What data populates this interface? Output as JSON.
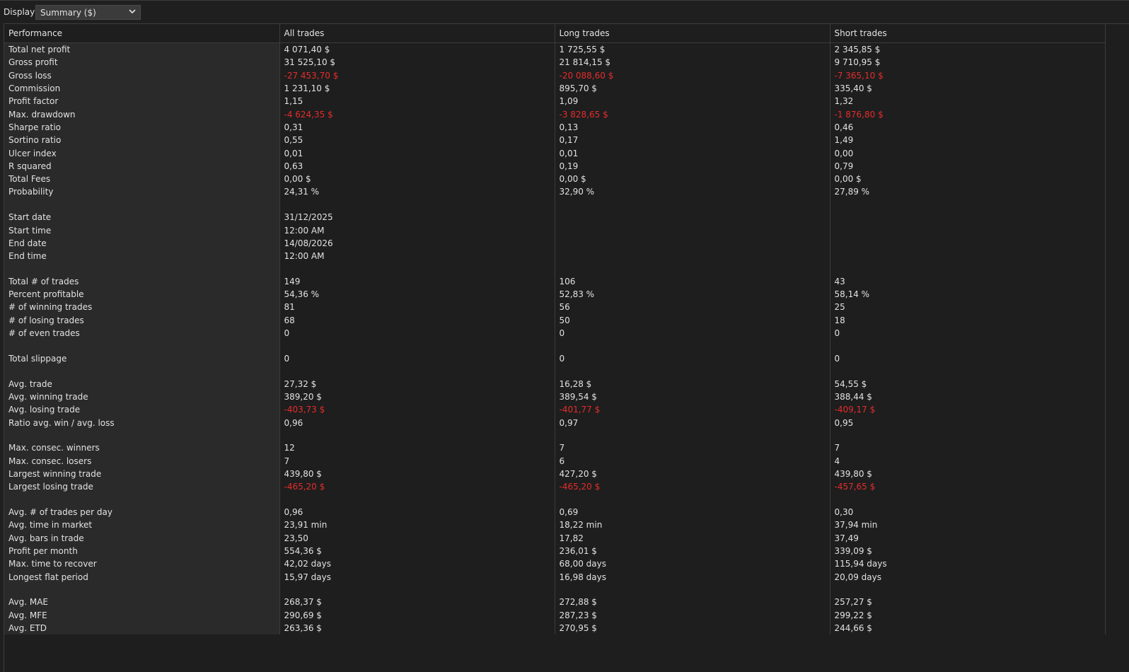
{
  "toolbar": {
    "display_label": "Display",
    "display_value": "Summary ($)"
  },
  "table": {
    "headers": [
      "Performance",
      "All trades",
      "Long trades",
      "Short trades"
    ],
    "rows": [
      {
        "label": "Total net profit",
        "all": "4 071,40 $",
        "long": "1 725,55 $",
        "short": "2 345,85 $"
      },
      {
        "label": "Gross profit",
        "all": "31 525,10 $",
        "long": "21 814,15 $",
        "short": "9 710,95 $"
      },
      {
        "label": "Gross loss",
        "all": "-27 453,70 $",
        "long": "-20 088,60 $",
        "short": "-7 365,10 $",
        "negative": true
      },
      {
        "label": "Commission",
        "all": "1 231,10 $",
        "long": "895,70 $",
        "short": "335,40 $"
      },
      {
        "label": "Profit factor",
        "all": "1,15",
        "long": "1,09",
        "short": "1,32"
      },
      {
        "label": "Max. drawdown",
        "all": "-4 624,35 $",
        "long": "-3 828,65 $",
        "short": "-1 876,80 $",
        "negative": true
      },
      {
        "label": "Sharpe ratio",
        "all": "0,31",
        "long": "0,13",
        "short": "0,46"
      },
      {
        "label": "Sortino ratio",
        "all": "0,55",
        "long": "0,17",
        "short": "1,49"
      },
      {
        "label": "Ulcer index",
        "all": "0,01",
        "long": "0,01",
        "short": "0,00"
      },
      {
        "label": "R squared",
        "all": "0,63",
        "long": "0,19",
        "short": "0,79"
      },
      {
        "label": "Total Fees",
        "all": "0,00 $",
        "long": "0,00 $",
        "short": "0,00 $"
      },
      {
        "label": "Probability",
        "all": "24,31 %",
        "long": "32,90 %",
        "short": "27,89 %"
      },
      {
        "gap": true
      },
      {
        "label": "Start date",
        "all": "31/12/2025",
        "long": "",
        "short": ""
      },
      {
        "label": "Start time",
        "all": "12:00 AM",
        "long": "",
        "short": ""
      },
      {
        "label": "End date",
        "all": "14/08/2026",
        "long": "",
        "short": ""
      },
      {
        "label": "End time",
        "all": "12:00 AM",
        "long": "",
        "short": ""
      },
      {
        "gap": true
      },
      {
        "label": "Total # of trades",
        "all": "149",
        "long": "106",
        "short": "43"
      },
      {
        "label": "Percent profitable",
        "all": "54,36 %",
        "long": "52,83 %",
        "short": "58,14 %"
      },
      {
        "label": "# of winning trades",
        "all": "81",
        "long": "56",
        "short": "25"
      },
      {
        "label": "# of losing trades",
        "all": "68",
        "long": "50",
        "short": "18"
      },
      {
        "label": "# of even trades",
        "all": "0",
        "long": "0",
        "short": "0"
      },
      {
        "gap": true
      },
      {
        "label": "Total slippage",
        "all": "0",
        "long": "0",
        "short": "0"
      },
      {
        "gap": true
      },
      {
        "label": "Avg. trade",
        "all": "27,32 $",
        "long": "16,28 $",
        "short": "54,55 $"
      },
      {
        "label": "Avg. winning trade",
        "all": "389,20 $",
        "long": "389,54 $",
        "short": "388,44 $"
      },
      {
        "label": "Avg. losing trade",
        "all": "-403,73 $",
        "long": "-401,77 $",
        "short": "-409,17 $",
        "negative": true
      },
      {
        "label": "Ratio avg. win / avg. loss",
        "all": "0,96",
        "long": "0,97",
        "short": "0,95"
      },
      {
        "gap": true
      },
      {
        "label": "Max. consec. winners",
        "all": "12",
        "long": "7",
        "short": "7"
      },
      {
        "label": "Max. consec. losers",
        "all": "7",
        "long": "6",
        "short": "4"
      },
      {
        "label": "Largest winning trade",
        "all": "439,80 $",
        "long": "427,20 $",
        "short": "439,80 $"
      },
      {
        "label": "Largest losing trade",
        "all": "-465,20 $",
        "long": "-465,20 $",
        "short": "-457,65 $",
        "negative": true
      },
      {
        "gap": true
      },
      {
        "label": "Avg. # of trades per day",
        "all": "0,96",
        "long": "0,69",
        "short": "0,30"
      },
      {
        "label": "Avg. time in market",
        "all": "23,91 min",
        "long": "18,22 min",
        "short": "37,94 min"
      },
      {
        "label": "Avg. bars in trade",
        "all": "23,50",
        "long": "17,82",
        "short": "37,49"
      },
      {
        "label": "Profit per month",
        "all": "554,36 $",
        "long": "236,01 $",
        "short": "339,09 $"
      },
      {
        "label": "Max. time to recover",
        "all": "42,02 days",
        "long": "68,00 days",
        "short": "115,94 days"
      },
      {
        "label": "Longest flat period",
        "all": "15,97 days",
        "long": "16,98 days",
        "short": "20,09 days"
      },
      {
        "gap": true
      },
      {
        "label": "Avg. MAE",
        "all": "268,37 $",
        "long": "272,88 $",
        "short": "257,27 $"
      },
      {
        "label": "Avg. MFE",
        "all": "290,69 $",
        "long": "287,23 $",
        "short": "299,22 $"
      },
      {
        "label": "Avg. ETD",
        "all": "263,36 $",
        "long": "270,95 $",
        "short": "244,66 $"
      }
    ]
  }
}
